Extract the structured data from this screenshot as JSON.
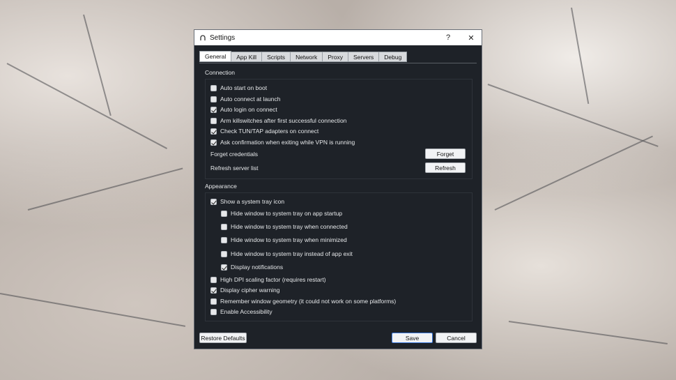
{
  "window": {
    "title": "Settings",
    "help": "?",
    "close": "✕"
  },
  "tabs": [
    "General",
    "App Kill",
    "Scripts",
    "Network",
    "Proxy",
    "Servers",
    "Debug"
  ],
  "connection": {
    "label": "Connection",
    "options": [
      {
        "label": "Auto start on boot",
        "checked": false
      },
      {
        "label": "Auto connect at launch",
        "checked": false
      },
      {
        "label": "Auto login on connect",
        "checked": true
      },
      {
        "label": "Arm killswitches after first successful connection",
        "checked": false
      },
      {
        "label": "Check TUN/TAP adapters on connect",
        "checked": true
      },
      {
        "label": "Ask confirmation when exiting while VPN is running",
        "checked": true
      }
    ],
    "forget_label": "Forget credentials",
    "forget_button": "Forget",
    "refresh_label": "Refresh server list",
    "refresh_button": "Refresh"
  },
  "appearance": {
    "label": "Appearance",
    "tray": {
      "label": "Show a system tray icon",
      "checked": true
    },
    "tray_sub": [
      {
        "label": "Hide window to system tray on app startup",
        "checked": false
      },
      {
        "label": "Hide window to system tray when connected",
        "checked": false
      },
      {
        "label": "Hide window to system tray when minimized",
        "checked": false
      },
      {
        "label": "Hide window to system tray instead of app exit",
        "checked": false
      },
      {
        "label": "Display notifications",
        "checked": true
      }
    ],
    "options": [
      {
        "label": "High DPI scaling factor (requires restart)",
        "checked": false
      },
      {
        "label": "Display cipher warning",
        "checked": true
      },
      {
        "label": "Remember window geometry (it could not work on some platforms)",
        "checked": false
      },
      {
        "label": "Enable Accessibility",
        "checked": false
      }
    ]
  },
  "footer": {
    "restore": "Restore Defaults",
    "save": "Save",
    "cancel": "Cancel"
  }
}
